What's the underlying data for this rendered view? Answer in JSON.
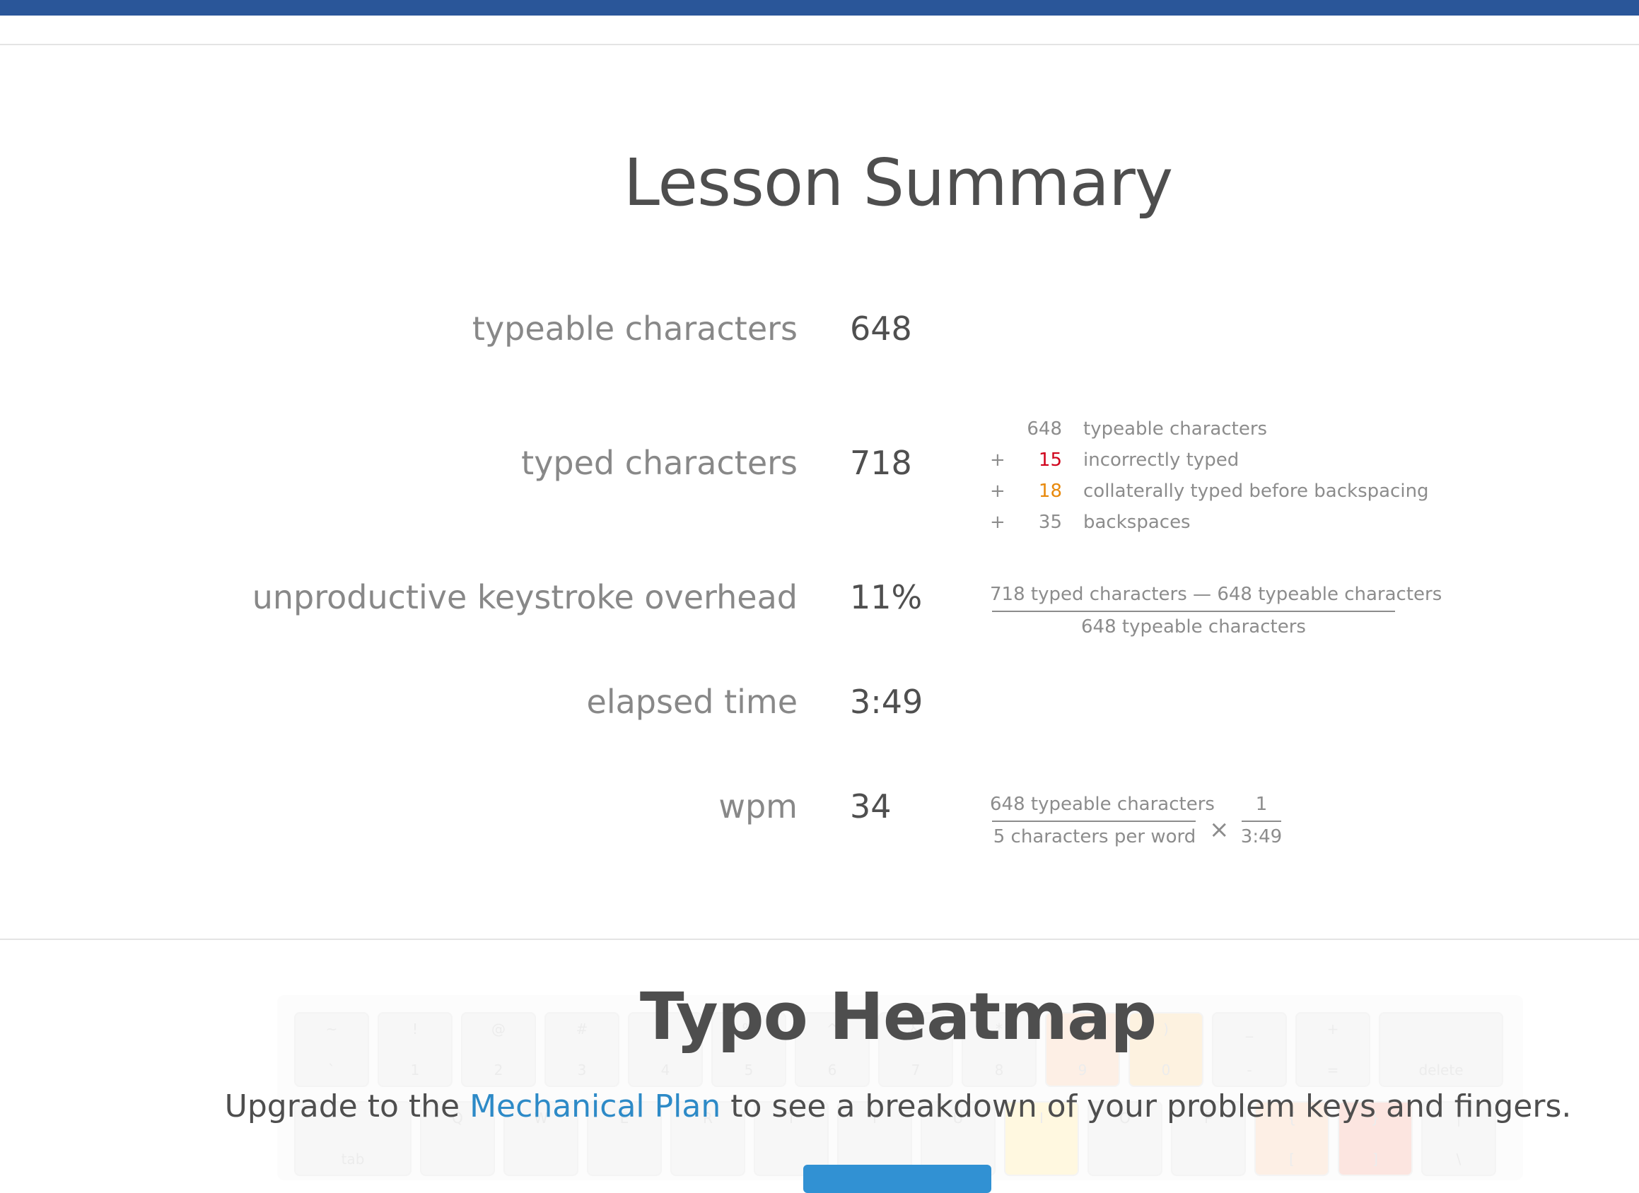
{
  "summary": {
    "title": "Lesson Summary",
    "rows": [
      {
        "label": "typeable characters",
        "value": "648"
      },
      {
        "label": "typed characters",
        "value": "718"
      },
      {
        "label": "unproductive keystroke overhead",
        "value": "11%"
      },
      {
        "label": "elapsed time",
        "value": "3:49"
      },
      {
        "label": "wpm",
        "value": "34"
      }
    ],
    "breakdown": [
      {
        "op": "",
        "num": "648",
        "text": "typeable characters",
        "color": "#8c8c8c"
      },
      {
        "op": "+",
        "num": "15",
        "text": "incorrectly typed",
        "color": "#d0021b"
      },
      {
        "op": "+",
        "num": "18",
        "text": "collaterally typed before backspacing",
        "color": "#e8890c"
      },
      {
        "op": "+",
        "num": "35",
        "text": "backspaces",
        "color": "#8c8c8c"
      }
    ],
    "overhead_formula": {
      "numerator": "718 typed characters — 648 typeable characters",
      "denominator": "648 typeable characters"
    },
    "wpm_formula": {
      "numerator": "648 typeable characters",
      "denominator": "5 characters per word",
      "times": "×",
      "numerator2": "1",
      "denominator2": "3:49"
    }
  },
  "heatmap": {
    "title": "Typo Heatmap",
    "upgrade_prefix": "Upgrade to the ",
    "upgrade_link": "Mechanical Plan",
    "upgrade_suffix": " to see a breakdown of your problem keys and fingers.",
    "keys_row1": [
      {
        "top": "~",
        "bot": "`"
      },
      {
        "top": "!",
        "bot": "1"
      },
      {
        "top": "@",
        "bot": "2"
      },
      {
        "top": "#",
        "bot": "3"
      },
      {
        "top": "$",
        "bot": "4"
      },
      {
        "top": "%",
        "bot": "5"
      },
      {
        "top": "^",
        "bot": "6"
      },
      {
        "top": "&",
        "bot": "7"
      },
      {
        "top": "*",
        "bot": "8"
      },
      {
        "top": "(",
        "bot": "9"
      },
      {
        "top": ")",
        "bot": "0"
      },
      {
        "top": "_",
        "bot": "-"
      },
      {
        "top": "+",
        "bot": "="
      },
      {
        "top": "",
        "bot": "delete"
      }
    ],
    "keys_row2": [
      {
        "top": "",
        "bot": "tab"
      },
      {
        "top": "Q",
        "bot": ""
      },
      {
        "top": "W",
        "bot": ""
      },
      {
        "top": "E",
        "bot": ""
      },
      {
        "top": "R",
        "bot": ""
      },
      {
        "top": "T",
        "bot": ""
      },
      {
        "top": "Y",
        "bot": ""
      },
      {
        "top": "U",
        "bot": ""
      },
      {
        "top": "I",
        "bot": ""
      },
      {
        "top": "O",
        "bot": ""
      },
      {
        "top": "P",
        "bot": ""
      },
      {
        "top": "{",
        "bot": "["
      },
      {
        "top": "}",
        "bot": "]"
      },
      {
        "top": "|",
        "bot": "\\"
      }
    ]
  }
}
